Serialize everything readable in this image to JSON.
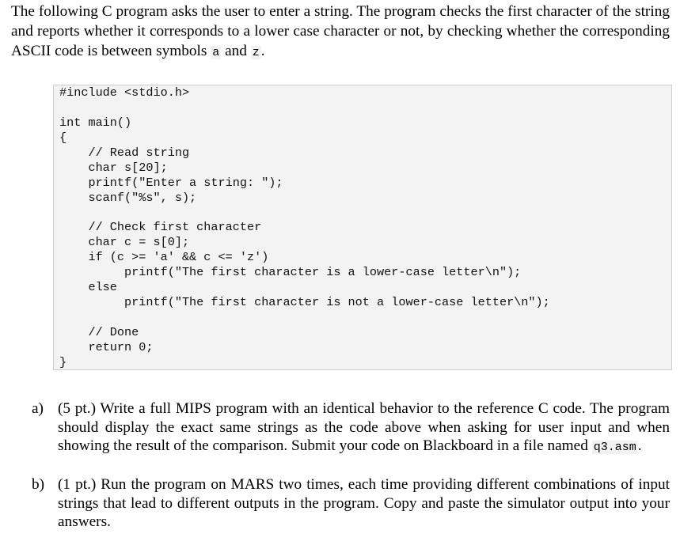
{
  "intro": {
    "text_before": "The following C program asks the user to enter a string. The program checks the first character of the string and reports whether it corresponds to a lower case character or not, by checking whether the corresponding ASCII code is between symbols ",
    "symbol_a": "a",
    "text_and": " and ",
    "symbol_z": "z",
    "text_end": "."
  },
  "code": {
    "lines": [
      "#include <stdio.h>",
      "",
      "int main()",
      "{",
      "    // Read string",
      "    char s[20];",
      "    printf(\"Enter a string: \");",
      "    scanf(\"%s\", s);",
      "",
      "    // Check first character",
      "    char c = s[0];",
      "    if (c >= 'a' && c <= 'z')",
      "         printf(\"The first character is a lower-case letter\\n\");",
      "    else",
      "         printf(\"The first character is not a lower-case letter\\n\");",
      "",
      "    // Done",
      "    return 0;",
      "}"
    ]
  },
  "questions": [
    {
      "label": "a)",
      "text": "(5 pt.) Write a full MIPS program with an identical behavior to the reference C code. The program should display the exact same strings as the code above when asking for user input and when showing the result of the comparison. Submit your code on Blackboard in a file named ",
      "filename": "q3.asm",
      "text_end": "."
    },
    {
      "label": "b)",
      "text": "(1 pt.) Run the program on MARS two times, each time providing different combinations of input strings that lead to different outputs in the program. Copy and paste the simulator output into your answers."
    }
  ]
}
